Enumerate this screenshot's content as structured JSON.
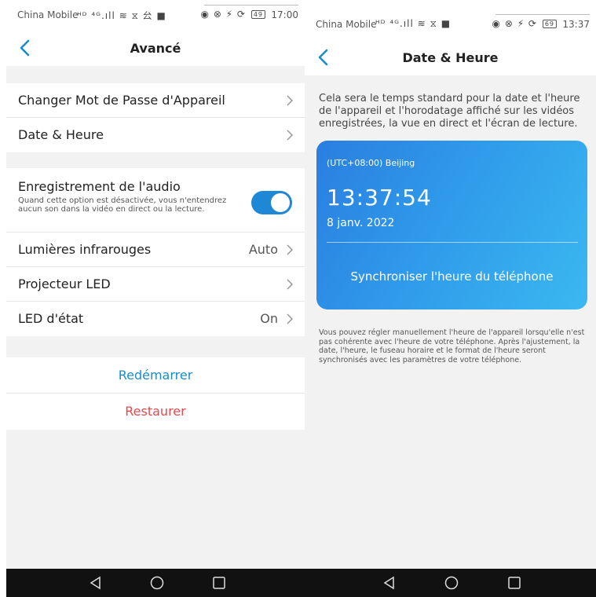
{
  "left": {
    "status": {
      "carrier": "China Mobile",
      "sys_icons": "ᴴᴰ ⁴ᴳ.ıll ≋ ⧖ 㕕 ■",
      "right_icons": "◉ ⊗ ⚡ ⟳",
      "battery": "49",
      "time": "17:00"
    },
    "nav": {
      "title": "Avancé"
    },
    "group1": [
      {
        "label": "Changer Mot de Passe d'Appareil"
      },
      {
        "label": "Date & Heure"
      }
    ],
    "audio": {
      "label": "Enregistrement de l'audio",
      "desc": "Quand cette option est désactivée, vous n'entendrez aucun son dans la vidéo en direct ou la lecture.",
      "enabled": true
    },
    "infrared": {
      "label": "Lumières infrarouges",
      "value": "Auto"
    },
    "projector": {
      "label": "Projecteur LED"
    },
    "status_led": {
      "label": "LED d'état",
      "value": "On"
    },
    "reboot": "Redémarrer",
    "restore": "Restaurer"
  },
  "right": {
    "status": {
      "carrier": "China Mobile",
      "sys_icons": "ᴴᴰ ⁴ᴳ.ıll ≋ ⧖ ■",
      "right_icons": "◉ ⊗ ⚡ ⟳",
      "battery": "69",
      "time": "13:37"
    },
    "nav": {
      "title": "Date & Heure"
    },
    "intro": "Cela sera le temps standard pour la date et l'heure de l'appareil et l'horodatage affiché sur les vidéos enregistrées, la vue en direct et l'écran de lecture.",
    "card": {
      "timezone": "(UTC+08:00) Beijing",
      "time": "13:37:54",
      "date": "8 janv. 2022",
      "sync_label": "Synchroniser l'heure du téléphone"
    },
    "note": "Vous pouvez régler manuellement l'heure de l'appareil lorsqu'elle n'est pas cohérente avec l'heure de votre téléphone. Après l'ajustement, la date, l'heure, le fuseau horaire et le format de l'heure seront synchronisés avec les paramètres de votre téléphone."
  },
  "colors": {
    "accent": "#1a8dc8",
    "toggle_on": "#1e88d6",
    "danger": "#e5484d",
    "card_gradient": [
      "#2a7ee0",
      "#3bb8f0"
    ]
  },
  "icons": {
    "back": "chevron-left-icon",
    "chevron": "chevron-right-icon",
    "nav_back": "triangle-back-icon",
    "nav_home": "circle-home-icon",
    "nav_recents": "square-recents-icon"
  }
}
